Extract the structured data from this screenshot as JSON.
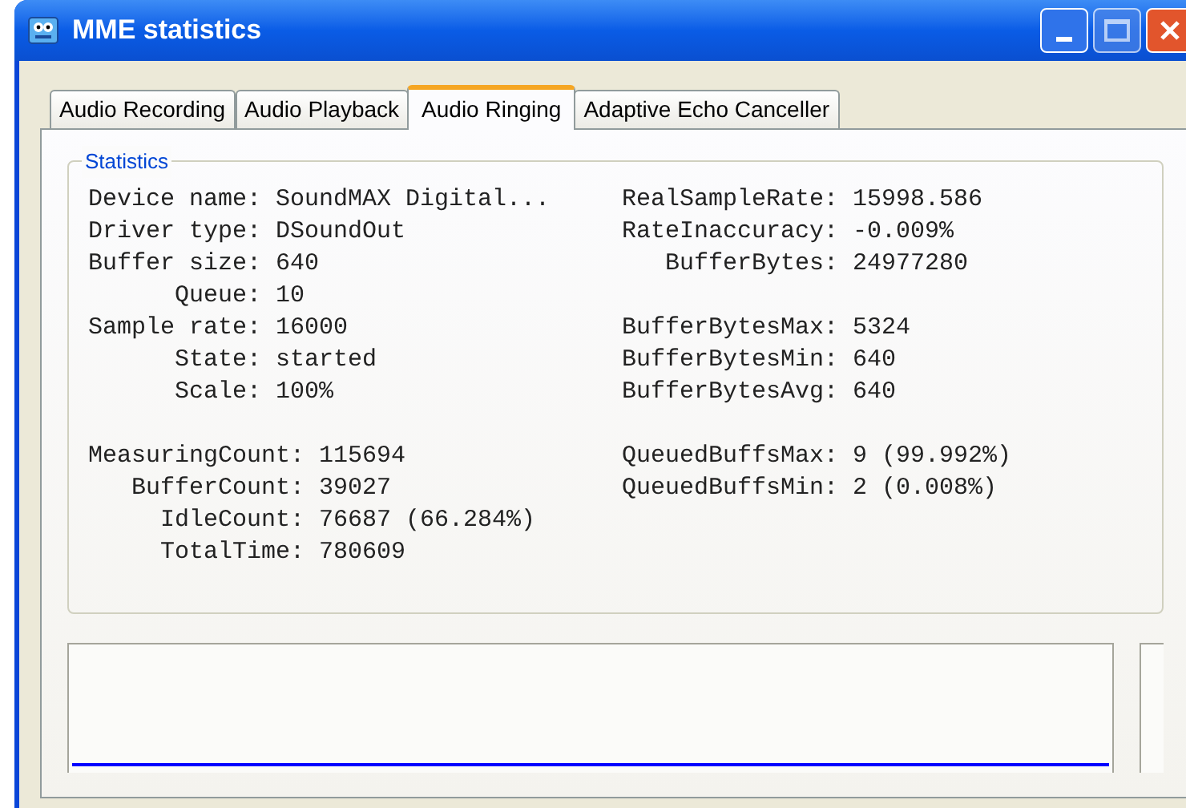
{
  "window": {
    "title": "MME statistics"
  },
  "tabs": [
    {
      "label": "Audio Recording",
      "selected": false
    },
    {
      "label": "Audio Playback",
      "selected": false
    },
    {
      "label": "Audio Ringing",
      "selected": true
    },
    {
      "label": "Adaptive Echo Canceller",
      "selected": false
    }
  ],
  "statistics": {
    "title": "Statistics",
    "left_groups": [
      [
        {
          "label": "Device name:",
          "value": "SoundMAX Digital..."
        },
        {
          "label": "Driver type:",
          "value": "DSoundOut"
        },
        {
          "label": "Buffer size:",
          "value": "640"
        },
        {
          "label": "Queue:",
          "value": "10"
        },
        {
          "label": "Sample rate:",
          "value": "16000"
        },
        {
          "label": "State:",
          "value": "started"
        },
        {
          "label": "Scale:",
          "value": "100%"
        }
      ],
      [
        {
          "label": "MeasuringCount:",
          "value": "115694"
        },
        {
          "label": "BufferCount:",
          "value": "39027"
        },
        {
          "label": "IdleCount:",
          "value": "76687 (66.284%)"
        },
        {
          "label": "TotalTime:",
          "value": "780609"
        }
      ]
    ],
    "right_groups": [
      [
        {
          "label": "RealSampleRate:",
          "value": "15998.586"
        },
        {
          "label": "RateInaccuracy:",
          "value": "-0.009%"
        },
        {
          "label": "BufferBytes:",
          "value": "24977280"
        }
      ],
      [
        {
          "label": "BufferBytesMax:",
          "value": "5324"
        },
        {
          "label": "BufferBytesMin:",
          "value": "640"
        },
        {
          "label": "BufferBytesAvg:",
          "value": "640"
        }
      ],
      [
        {
          "label": "QueuedBuffsMax:",
          "value": "9 (99.992%)"
        },
        {
          "label": "QueuedBuffsMin:",
          "value": "2 (0.008%)"
        }
      ]
    ]
  }
}
